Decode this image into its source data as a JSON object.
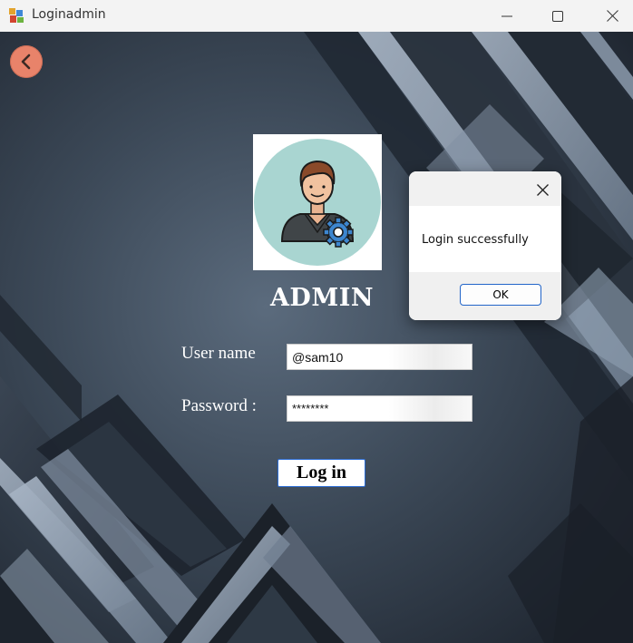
{
  "window": {
    "title": "Loginadmin"
  },
  "form": {
    "heading": "ADMIN",
    "username_label": "User name",
    "username_value": "@sam10",
    "password_label": "Password :",
    "password_value": "********",
    "login_button": "Log in"
  },
  "dialog": {
    "message": "Login successfully",
    "ok_label": "OK"
  },
  "colors": {
    "back_button": "#e8836a",
    "avatar_circle": "#a9d5d1",
    "background": "#2b3440",
    "accent": "#2265c9"
  },
  "icons": {
    "app": "windows-forms-icon",
    "back": "back-arrow-icon",
    "avatar": "admin-avatar-gear-icon"
  }
}
